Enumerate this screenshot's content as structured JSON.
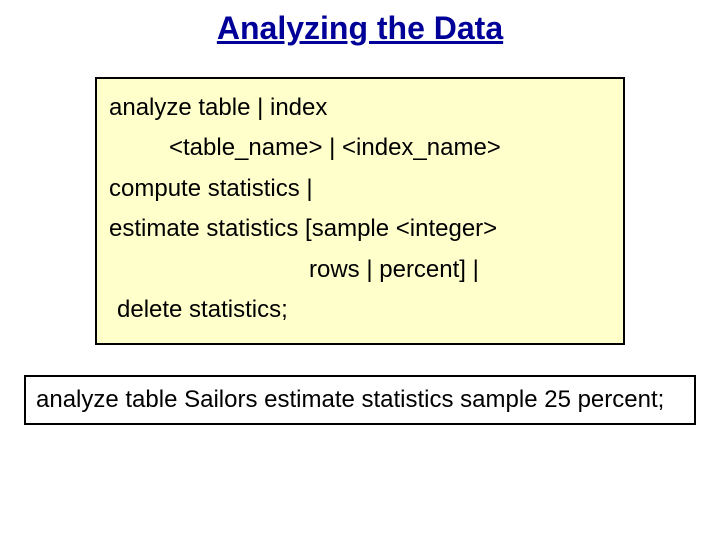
{
  "title": "Analyzing the Data",
  "syntax": {
    "line1": "analyze table | index",
    "line2": "<table_name> | <index_name>",
    "line3": "compute statistics |",
    "line4": "estimate statistics [sample <integer>",
    "line5": "rows | percent] |",
    "line6": "delete statistics;"
  },
  "example": "analyze table Sailors estimate statistics sample 25 percent;"
}
